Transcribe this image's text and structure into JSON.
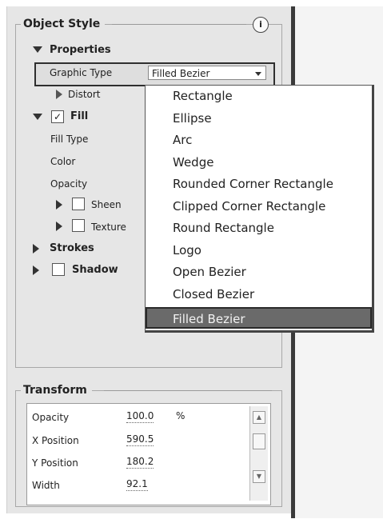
{
  "object_style": {
    "title": "Object Style",
    "info_icon": "info-icon",
    "properties_label": "Properties",
    "graphic_type_label": "Graphic Type",
    "graphic_type_value": "Filled Bezier",
    "distort_label": "Distort",
    "fill_label": "Fill",
    "fill_checked": true,
    "fill_type_label": "Fill Type",
    "color_label": "Color",
    "opacity_label": "Opacity",
    "sheen_label": "Sheen",
    "texture_label": "Texture",
    "strokes_label": "Strokes",
    "shadow_label": "Shadow"
  },
  "dropdown": {
    "options": [
      "Rectangle",
      "Ellipse",
      "Arc",
      "Wedge",
      "Rounded Corner Rectangle",
      "Clipped Corner Rectangle",
      "Round Rectangle",
      "Logo",
      "Open Bezier",
      "Closed Bezier"
    ],
    "selected": "Filled Bezier"
  },
  "transform": {
    "title": "Transform",
    "fields": [
      {
        "label": "Opacity",
        "value": "100.0",
        "unit": "%"
      },
      {
        "label": "X Position",
        "value": "590.5",
        "unit": ""
      },
      {
        "label": "Y Position",
        "value": "180.2",
        "unit": ""
      },
      {
        "label": "Width",
        "value": "92.1",
        "unit": ""
      }
    ]
  },
  "glyphs": {
    "check": "✓",
    "info": "i"
  }
}
